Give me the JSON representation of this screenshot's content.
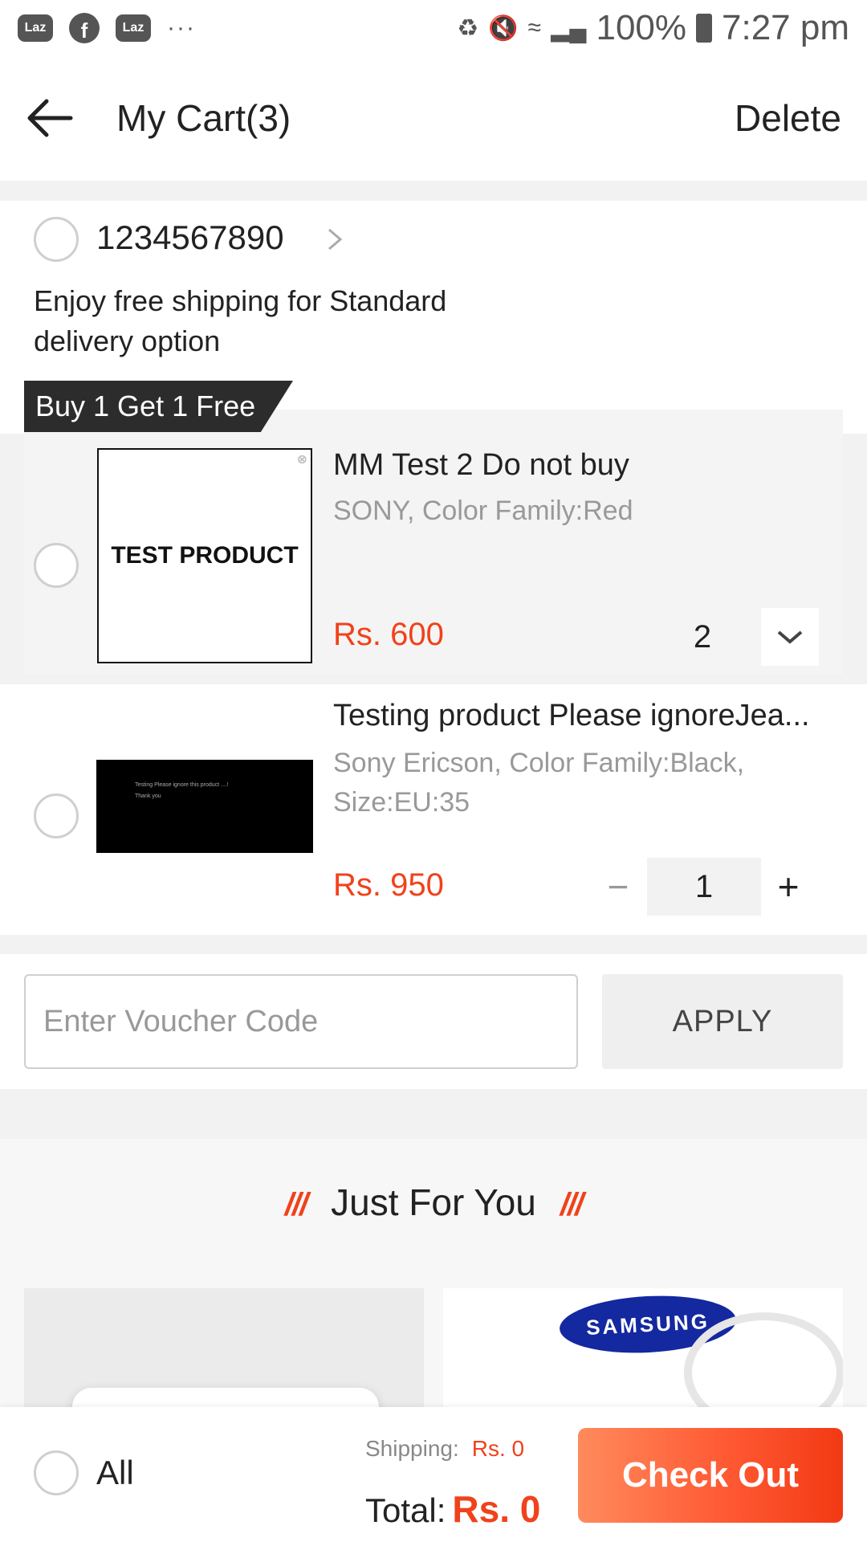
{
  "status_bar": {
    "app_icons": [
      "Laz",
      "f",
      "Laz"
    ],
    "more": "···",
    "battery_percent": "100%",
    "time": "7:27 pm"
  },
  "header": {
    "title": "My Cart(3)",
    "delete_label": "Delete"
  },
  "shop": {
    "name": "1234567890",
    "shipping_note": "Enjoy free shipping for Standard delivery option",
    "promo_tag": "Buy 1 Get 1 Free"
  },
  "items": [
    {
      "title": "MM Test 2 Do not buy",
      "variant": "SONY, Color Family:Red",
      "price": "Rs. 600",
      "quantity": "2",
      "image_text": "TEST PRODUCT"
    },
    {
      "title": "Testing product Please ignoreJea...",
      "variant": "Sony Ericson, Color Family:Black, Size:EU:35",
      "price": "Rs. 950",
      "quantity": "1",
      "minus": "−",
      "plus": "+",
      "image_text_1": "Testing Please ignore this product ....!",
      "image_text_2": "Thank you"
    }
  ],
  "voucher": {
    "placeholder": "Enter Voucher Code",
    "apply_label": "APPLY"
  },
  "just_for_you": {
    "title": "Just For You",
    "deco": "///",
    "brand": "SAMSUNG"
  },
  "bottom": {
    "all_label": "All",
    "shipping_label": "Shipping:",
    "shipping_value": "Rs. 0",
    "total_label": "Total:",
    "total_value": "Rs. 0",
    "checkout_label": "Check Out"
  },
  "colors": {
    "accent": "#f0421b",
    "checkout_start": "#ff8a5c",
    "checkout_end": "#f23a14"
  }
}
